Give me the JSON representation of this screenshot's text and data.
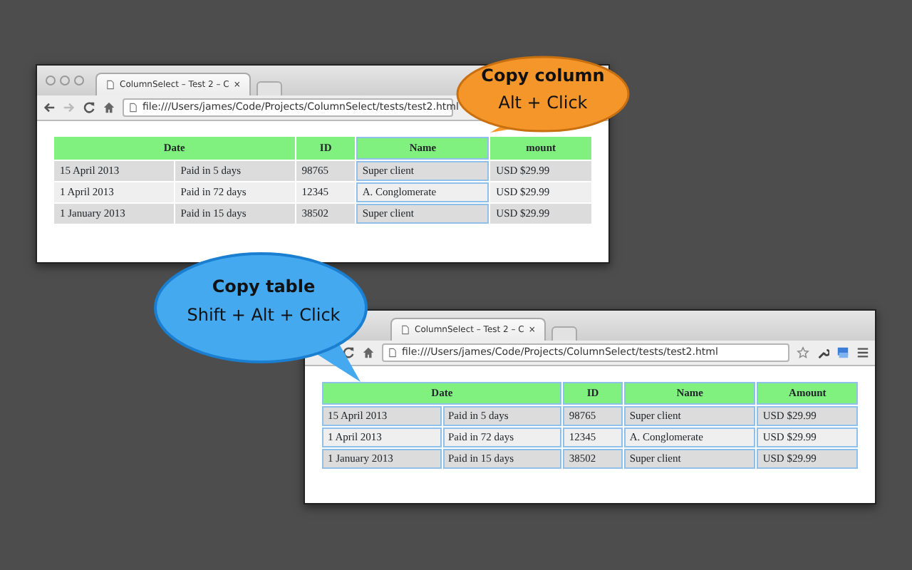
{
  "windows": [
    {
      "kind": "back",
      "tab_title": "ColumnSelect – Test 2 – C",
      "tab_close": "×",
      "url": "file:///Users/james/Code/Projects/ColumnSelect/tests/test2.html",
      "table": {
        "selected": false,
        "columns": [
          {
            "label": "Date",
            "colspan": 2,
            "selected": false
          },
          {
            "label": "ID",
            "selected": false
          },
          {
            "label": "Name",
            "selected": true
          },
          {
            "label": "mount",
            "selected": false
          }
        ],
        "rows": [
          [
            "15 April 2013",
            "Paid in 5 days",
            "98765",
            "Super client",
            "USD $29.99"
          ],
          [
            "1 April 2013",
            "Paid in 72 days",
            "12345",
            "A. Conglomerate",
            "USD $29.99"
          ],
          [
            "1 January 2013",
            "Paid in 15 days",
            "38502",
            "Super client",
            "USD $29.99"
          ]
        ]
      }
    },
    {
      "kind": "front",
      "tab_title": "ColumnSelect – Test 2 – C",
      "tab_close": "×",
      "url": "file:///Users/james/Code/Projects/ColumnSelect/tests/test2.html",
      "table": {
        "selected": true,
        "columns": [
          {
            "label": "Date",
            "colspan": 2
          },
          {
            "label": "ID"
          },
          {
            "label": "Name"
          },
          {
            "label": "Amount"
          }
        ],
        "rows": [
          [
            "15 April 2013",
            "Paid in 5 days",
            "98765",
            "Super client",
            "USD $29.99"
          ],
          [
            "1 April 2013",
            "Paid in 72 days",
            "12345",
            "A. Conglomerate",
            "USD $29.99"
          ],
          [
            "1 January 2013",
            "Paid in 15 days",
            "38502",
            "Super client",
            "USD $29.99"
          ]
        ]
      }
    }
  ],
  "callouts": [
    {
      "title": "Copy column",
      "shortcut": "Alt + Click",
      "color": "#f5962a"
    },
    {
      "title": "Copy table",
      "shortcut": "Shift + Alt + Click",
      "color": "#45a9f0"
    }
  ]
}
